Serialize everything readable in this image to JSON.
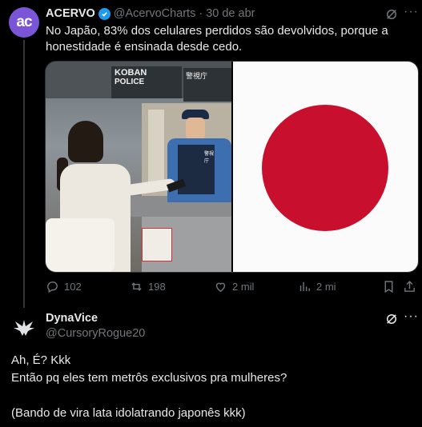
{
  "tweet": {
    "avatar_text": "ac",
    "author_name": "ACERVO",
    "handle": "@AcervoCharts",
    "separator": "·",
    "date": "30 de abr",
    "text": "No Japão, 83% dos celulares perdidos são devolvidos, porque a honestidade é ensinada desde cedo.",
    "media": {
      "koban_sign_line1": "KOBAN",
      "koban_sign_line2": "POLICE",
      "koban_kanji": "警視庁",
      "officer_badge": "警視庁"
    },
    "stats": {
      "replies": "102",
      "retweets": "198",
      "likes": "2 mil",
      "views": "2 mi"
    }
  },
  "reply": {
    "author_name": "DynaVice",
    "handle": "@CursoryRogue20",
    "lines": [
      "Ah, É? Kkk",
      "Então pq eles tem metrôs exclusivos pra mulheres?",
      "",
      "(Bando de vira lata idolatrando japonês kkk)"
    ]
  },
  "colors": {
    "background": "#000000",
    "text": "#e7e9ea",
    "muted": "#71767b",
    "verified": "#1d9bf0",
    "avatar": "#7b55d8",
    "flag_red": "#c8102e"
  }
}
